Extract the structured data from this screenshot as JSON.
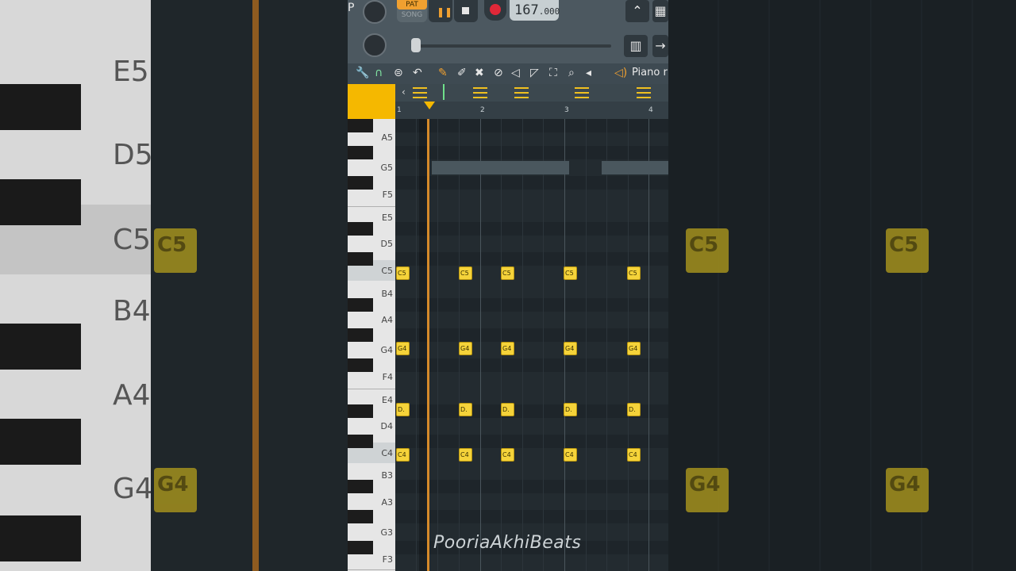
{
  "background_left": {
    "labels": [
      "E5",
      "D5",
      "C5",
      "B4",
      "A4",
      "G4"
    ],
    "notes": [
      "C5",
      "G4"
    ]
  },
  "background_right": {
    "notes": [
      "C5",
      "C5",
      "G4",
      "G4"
    ]
  },
  "transport": {
    "pat_label": "PAT",
    "song_label": "SONG",
    "tempo_main": "167",
    "tempo_frac": ".000",
    "left_fragment": "P"
  },
  "toolbar": {
    "title": "Piano r"
  },
  "ruler": {
    "bars": [
      "1",
      "2",
      "3",
      "4"
    ]
  },
  "keyboard": {
    "labels": [
      "A5",
      "G5",
      "F5",
      "E5",
      "D5",
      "C5",
      "B4",
      "A4",
      "G4",
      "F4",
      "E4",
      "D4",
      "C4",
      "B3",
      "A3",
      "G3",
      "F3"
    ]
  },
  "notes": {
    "c5": [
      "C5",
      "C5",
      "C5",
      "C5",
      "C5"
    ],
    "g4": [
      "G4",
      "G4",
      "G4",
      "G4",
      "G4"
    ],
    "d4": [
      "D.",
      "D.",
      "D.",
      "D.",
      "D."
    ],
    "c4": [
      "C4",
      "C4",
      "C4",
      "C4",
      "C4"
    ]
  },
  "watermark": "PooriaAkhiBeats",
  "colors": {
    "accent": "#f5b800",
    "note": "#f5d33a",
    "record": "#e02838",
    "playhead": "#d58a2a"
  }
}
